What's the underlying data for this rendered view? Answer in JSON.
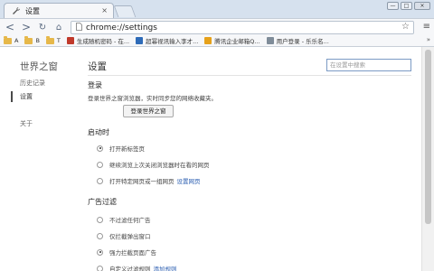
{
  "tab": {
    "title": "设置",
    "close": "×",
    "icon": "wrench-icon"
  },
  "window_buttons": [
    "—",
    "□",
    "×"
  ],
  "toolbar": {
    "back": "<",
    "forward": ">",
    "reload": "↻",
    "home": "⌂",
    "url": "chrome://settings",
    "star": "☆",
    "menu": "≡"
  },
  "bookmarks": [
    {
      "label": "A",
      "kind": "folder"
    },
    {
      "label": "B",
      "kind": "folder"
    },
    {
      "label": "T",
      "kind": "folder"
    },
    {
      "label": "生成随机密码 - 在...",
      "kind": "site",
      "color": "#c0392b"
    },
    {
      "label": "超幂视讯输入李才...",
      "kind": "site",
      "color": "#2e6bb8"
    },
    {
      "label": "腾讯企业邮箱Q...",
      "kind": "site",
      "color": "#e6a11a"
    },
    {
      "label": "用户登录 - 乐乐名...",
      "kind": "site",
      "color": "#7f8c99"
    }
  ],
  "bookmarks_more": "»",
  "sidebar": {
    "title": "世界之窗",
    "items": [
      {
        "label": "历史记录"
      },
      {
        "label": "设置"
      },
      {
        "label": "关于"
      }
    ]
  },
  "main": {
    "title": "设置",
    "search_placeholder": "在设置中搜索",
    "login": {
      "title": "登录",
      "desc": "登录世界之窗浏览器，实时同步您的网络收藏夹。",
      "button": "登录世界之窗"
    },
    "startup": {
      "title": "启动时",
      "options": [
        {
          "label": "打开新标签页",
          "checked": true
        },
        {
          "label": "继续浏览上次关闭浏览器时在看的网页",
          "checked": false
        },
        {
          "label": "打开特定网页或一组网页",
          "checked": false,
          "link": "设置网页"
        }
      ]
    },
    "adblock": {
      "title": "广告过滤",
      "options": [
        {
          "label": "不过滤任何广告",
          "checked": false
        },
        {
          "label": "仅拦截弹出窗口",
          "checked": false
        },
        {
          "label": "强力拦截页面广告",
          "checked": true
        },
        {
          "label": "自定义过滤规则",
          "checked": false,
          "link": "添加规则"
        }
      ]
    }
  }
}
